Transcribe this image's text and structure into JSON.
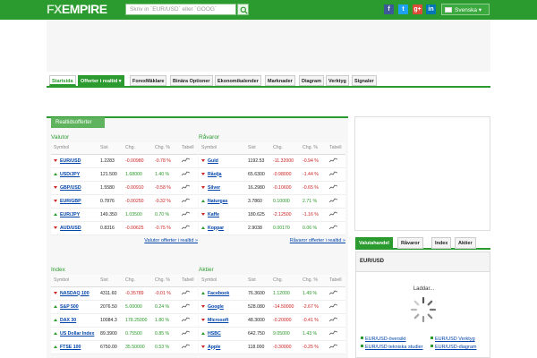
{
  "header": {
    "logo_fx": "FX",
    "logo_empire": "EMPIRE",
    "search_placeholder": "Skriv in ´EUR/USD´ eller ´GOOG´",
    "language": "Svenska",
    "social": [
      {
        "name": "facebook-icon",
        "glyph": "f",
        "color": "#3b5998"
      },
      {
        "name": "twitter-icon",
        "glyph": "t",
        "color": "#1da1f2"
      },
      {
        "name": "google-plus-icon",
        "glyph": "g+",
        "color": "#dd4b39"
      },
      {
        "name": "linkedin-icon",
        "glyph": "in",
        "color": "#0077b5"
      }
    ]
  },
  "nav": {
    "items": [
      "Startsida",
      "Offerter i realtid",
      "ForexMäklare",
      "Binära Optioner",
      "Ekonomikalender",
      "Marknader",
      "Diagram",
      "Verktyg",
      "Signaler"
    ]
  },
  "panel": {
    "tab": "Realtidsofferter"
  },
  "columns": {
    "symbol": "Symbol",
    "price": "Sist",
    "chg": "Chg.",
    "chg_pct": "Chg. %",
    "table": "Tabell"
  },
  "valutor": {
    "title": "Valutor",
    "rows": [
      {
        "name": "EUR/USD",
        "price": "1.2283",
        "chg": "-0.00980",
        "pct": "-0.78 %",
        "dir": "dn"
      },
      {
        "name": "USD/JPY",
        "price": "121.500",
        "chg": "1.68000",
        "pct": "1.40 %",
        "dir": "up"
      },
      {
        "name": "GBP/USD",
        "price": "1.5580",
        "chg": "-0.00910",
        "pct": "-0.58 %",
        "dir": "dn"
      },
      {
        "name": "EUR/GBP",
        "price": "0.7876",
        "chg": "-0.00250",
        "pct": "-0.32 %",
        "dir": "dn"
      },
      {
        "name": "EUR/JPY",
        "price": "149.350",
        "chg": "1.03500",
        "pct": "0.70 %",
        "dir": "up"
      },
      {
        "name": "AUD/USD",
        "price": "0.8316",
        "chg": "-0.00625",
        "pct": "-0.75 %",
        "dir": "dn"
      }
    ],
    "more": "Valutor offerter i realtid »"
  },
  "ravaror": {
    "title": "Råvaror",
    "rows": [
      {
        "name": "Guld",
        "price": "1192.53",
        "chg": "-11.32000",
        "pct": "-0.94 %",
        "dir": "dn"
      },
      {
        "name": "Råolja",
        "price": "65.6300",
        "chg": "-0.98000",
        "pct": "-1.44 %",
        "dir": "dn"
      },
      {
        "name": "Silver",
        "price": "16.2980",
        "chg": "-0.10600",
        "pct": "-0.65 %",
        "dir": "dn"
      },
      {
        "name": "Naturgas",
        "price": "3.7860",
        "chg": "0.10000",
        "pct": "2.71 %",
        "dir": "up"
      },
      {
        "name": "Kaffe",
        "price": "180.625",
        "chg": "-2.12500",
        "pct": "-1.16 %",
        "dir": "dn"
      },
      {
        "name": "Koppar",
        "price": "2.9038",
        "chg": "0.00170",
        "pct": "0.06 %",
        "dir": "up"
      }
    ],
    "more": "Råvaror offerter i realtid »"
  },
  "index": {
    "title": "Index",
    "rows": [
      {
        "name": "NASDAQ 100",
        "price": "4311.60",
        "chg": "-0.35789",
        "pct": "-0.01 %",
        "dir": "dn"
      },
      {
        "name": "S&P 500",
        "price": "2076.50",
        "chg": "5.00000",
        "pct": "0.24 %",
        "dir": "up"
      },
      {
        "name": "DAX 30",
        "price": "10084.3",
        "chg": "178.25000",
        "pct": "1.80 %",
        "dir": "up"
      },
      {
        "name": "US Dollar Index",
        "price": "89.3900",
        "chg": "0.75500",
        "pct": "0.85 %",
        "dir": "up"
      },
      {
        "name": "FTSE 100",
        "price": "6750.00",
        "chg": "35.50000",
        "pct": "0.53 %",
        "dir": "up"
      }
    ]
  },
  "aktier": {
    "title": "Aktier",
    "rows": [
      {
        "name": "Facebook",
        "price": "76.3600",
        "chg": "1.12000",
        "pct": "1.49 %",
        "dir": "up"
      },
      {
        "name": "Google",
        "price": "528.080",
        "chg": "-14.50000",
        "pct": "-2.67 %",
        "dir": "dn"
      },
      {
        "name": "Microsoft",
        "price": "48.3000",
        "chg": "-0.20000",
        "pct": "-0.41 %",
        "dir": "dn"
      },
      {
        "name": "HSBC",
        "price": "642.750",
        "chg": "9.05000",
        "pct": "1.43 %",
        "dir": "up"
      },
      {
        "name": "Apple",
        "price": "118.000",
        "chg": "-0.30000",
        "pct": "-0.25 %",
        "dir": "dn"
      }
    ]
  },
  "right": {
    "tabs": [
      "Valutahandel",
      "Råvaror",
      "Index",
      "Aktier"
    ],
    "pair": "EUR/USD",
    "loading": "Laddar...",
    "links": [
      "EUR/USD-översikt",
      "EUR/USD Verktyg",
      "EUR/USD tekniska studier",
      "EUR/USD-diagram"
    ]
  }
}
